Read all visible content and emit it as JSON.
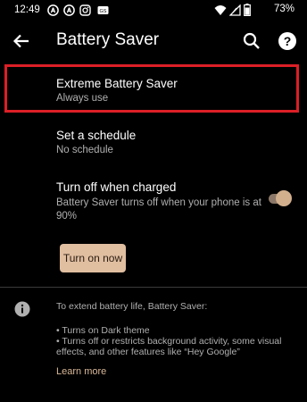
{
  "status_bar": {
    "time": "12:49",
    "battery_percent": "73%",
    "notification_icons": [
      "notification-a-icon",
      "notification-a-icon",
      "instagram-icon",
      "gallery-icon"
    ],
    "system_icons": [
      "wifi-icon",
      "cellular-icon",
      "battery-icon"
    ]
  },
  "app_bar": {
    "title": "Battery Saver",
    "back_icon": "arrow-back-icon",
    "search_icon": "search-icon",
    "help_icon": "help-icon"
  },
  "items": [
    {
      "title": "Extreme Battery Saver",
      "summary": "Always use",
      "highlighted": true
    },
    {
      "title": "Set a schedule",
      "summary": "No schedule"
    },
    {
      "title": "Turn off when charged",
      "summary": "Battery Saver turns off when your phone is at 90%",
      "toggle_on": true
    }
  ],
  "turn_on_button": {
    "label": "Turn on now"
  },
  "footer": {
    "intro": "To extend battery life, Battery Saver:",
    "bullets": [
      "• Turns on Dark theme",
      "• Turns off or restricts background activity, some visual",
      "effects, and other features like “Hey Google”"
    ],
    "learn_more": "Learn more"
  },
  "colors": {
    "background": "#000000",
    "accent": "#e0bea0",
    "highlight_border": "#dc1f26",
    "text_primary": "#ffffff",
    "text_secondary": "#b0b0b0"
  }
}
